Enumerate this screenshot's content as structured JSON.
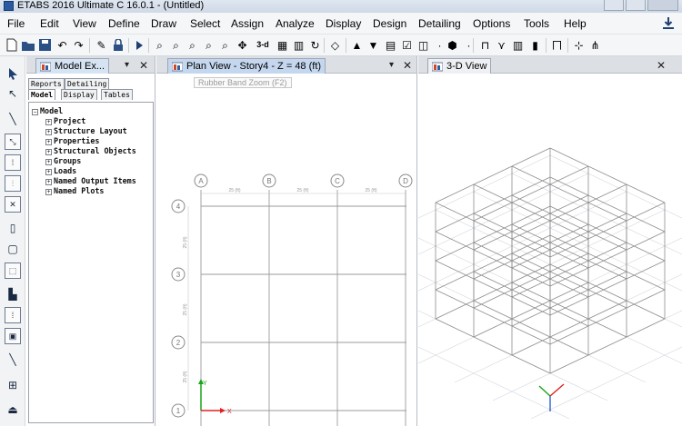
{
  "window": {
    "title": "ETABS 2016 Ultimate C 16.0.1 - (Untitled)"
  },
  "menu": [
    "File",
    "Edit",
    "View",
    "Define",
    "Draw",
    "Select",
    "Assign",
    "Analyze",
    "Display",
    "Design",
    "Detailing",
    "Options",
    "Tools",
    "Help"
  ],
  "toolbar": {
    "view_3d_label": "3-d"
  },
  "model_explorer": {
    "tab_label": "Model Ex...",
    "subtabs": [
      "Reports",
      "Detailing",
      "Model",
      "Display",
      "Tables"
    ],
    "tree_root": "Model",
    "tree_items": [
      "Project",
      "Structure Layout",
      "Properties",
      "Structural Objects",
      "Groups",
      "Loads",
      "Named Output Items",
      "Named Plots"
    ]
  },
  "plan_view": {
    "tab_label": "Plan View - Story4 - Z = 48 (ft)",
    "tooltip": "Rubber Band Zoom (F2)",
    "grid_columns": [
      "A",
      "B",
      "C",
      "D"
    ],
    "grid_rows": [
      "4",
      "3",
      "2",
      "1"
    ],
    "bay_x_label": "25 (ft)",
    "bay_y_label": "25 (ft)",
    "axis_x_label": "X",
    "axis_y_label": "Y"
  },
  "view_3d": {
    "tab_label": "3-D View"
  },
  "colors": {
    "grid_line": "#9b9b9b",
    "bubble": "#8a8a8a",
    "axis_x": "#e02020",
    "axis_y": "#1aa31a",
    "axis_z": "#2a60d0",
    "tab_active": "#c5d7ef"
  }
}
